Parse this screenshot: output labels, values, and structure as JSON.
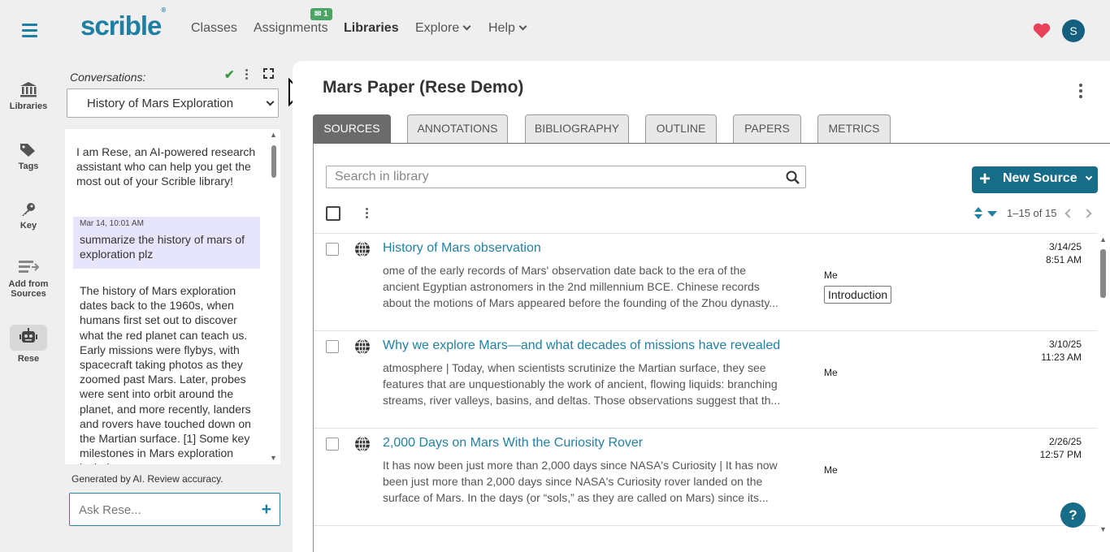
{
  "app": {
    "logo": "scrible",
    "logo_mark": "®"
  },
  "nav": {
    "classes": "Classes",
    "assignments": "Assignments",
    "assignments_badge": "1",
    "libraries": "Libraries",
    "explore": "Explore",
    "help": "Help",
    "avatar_initial": "S"
  },
  "rail": {
    "libraries": "Libraries",
    "tags": "Tags",
    "key": "Key",
    "add_from_line1": "Add from",
    "add_from_line2": "Sources",
    "rese": "Rese"
  },
  "conversation": {
    "label": "Conversations:",
    "selected": "History of Mars Exploration",
    "intro": "I am Rese, an AI-powered research assistant who can help you get the most out of your Scrible library!",
    "user_time": "Mar 14, 10:01 AM",
    "user_msg": "summarize the history of mars of exploration plz",
    "reply": "The history of Mars exploration dates back to the 1960s, when humans first set out to discover what the red planet can teach us. Early missions were flybys, with spacecraft taking photos as they zoomed past Mars. Later, probes were sent into orbit around the planet, and more recently, landers and rovers have touched down on the Martian surface. [1] Some key milestones in Mars exploration include:",
    "disclaimer": "Generated by AI. Review accuracy.",
    "ask_placeholder": "Ask Rese..."
  },
  "main": {
    "title": "Mars Paper (Rese Demo)",
    "tabs": [
      "SOURCES",
      "ANNOTATIONS",
      "BIBLIOGRAPHY",
      "OUTLINE",
      "PAPERS",
      "METRICS"
    ],
    "search_placeholder": "Search in library",
    "new_source": "New Source",
    "pager": "1–15 of 15"
  },
  "sources": [
    {
      "title": "History of Mars observation",
      "desc": "ome of the early records of Mars' observation date back to the era of the ancient Egyptian astronomers in the 2nd millennium BCE. Chinese records about the motions of Mars appeared before the founding of the Zhou dynasty...",
      "owner": "Me",
      "date": "3/14/25",
      "time": "8:51 AM",
      "tag": "Introduction"
    },
    {
      "title": "Why we explore Mars—and what decades of missions have revealed",
      "desc": "atmosphere | Today, when scientists scrutinize the Martian surface, they see features that are unquestionably the work of ancient, flowing liquids: branching streams, river valleys, basins, and deltas. Those observations suggest that th...",
      "owner": "Me",
      "date": "3/10/25",
      "time": "11:23 AM"
    },
    {
      "title": "2,000 Days on Mars With the Curiosity Rover",
      "desc": "It has now been just more than 2,000 days since NASA's Curiosity | It has now been just more than 2,000 days since NASA's Curiosity rover landed on the surface of Mars. In the days (or “sols,” as they are called on Mars) since its...",
      "owner": "Me",
      "date": "2/26/25",
      "time": "12:57 PM"
    }
  ],
  "colors": {
    "accent": "#1f7fa3",
    "primary_button": "#176c88",
    "heart": "#e8415a",
    "badge": "#4aa564"
  }
}
